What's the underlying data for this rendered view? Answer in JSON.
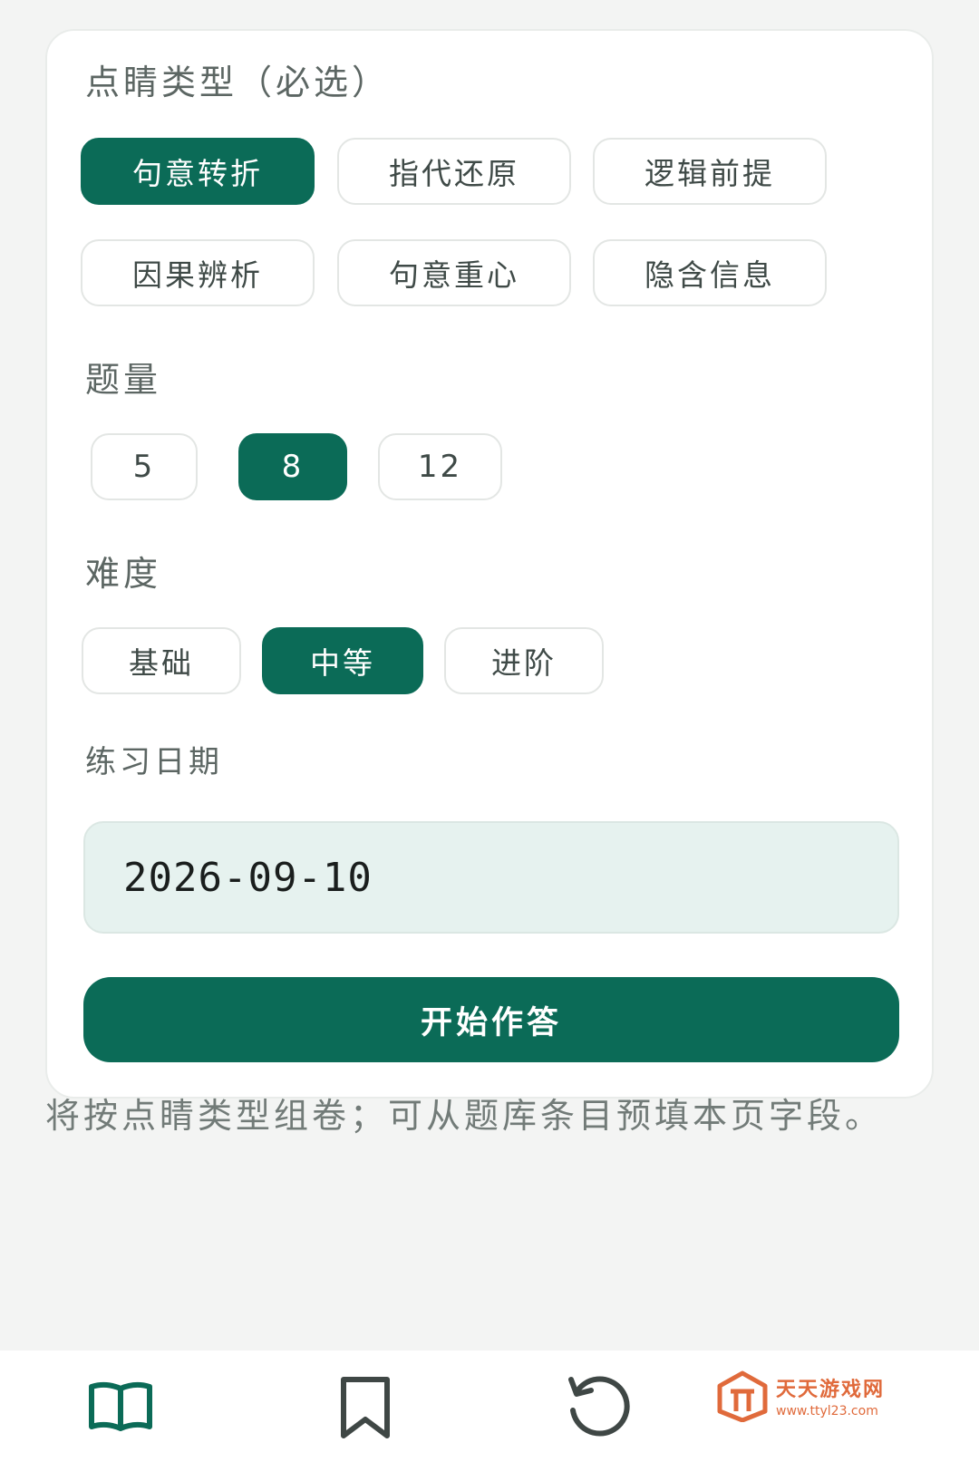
{
  "form": {
    "type_section": {
      "label": "点睛类型（必选）",
      "options": [
        {
          "label": "句意转折",
          "selected": true
        },
        {
          "label": "指代还原",
          "selected": false
        },
        {
          "label": "逻辑前提",
          "selected": false
        },
        {
          "label": "因果辨析",
          "selected": false
        },
        {
          "label": "句意重心",
          "selected": false
        },
        {
          "label": "隐含信息",
          "selected": false
        }
      ]
    },
    "count_section": {
      "label": "题量",
      "options": [
        {
          "label": "5",
          "selected": false
        },
        {
          "label": "8",
          "selected": true
        },
        {
          "label": "12",
          "selected": false
        }
      ]
    },
    "difficulty_section": {
      "label": "难度",
      "options": [
        {
          "label": "基础",
          "selected": false
        },
        {
          "label": "中等",
          "selected": true
        },
        {
          "label": "进阶",
          "selected": false
        }
      ]
    },
    "date_section": {
      "label": "练习日期",
      "value": "2026-09-10"
    },
    "start_button_label": "开始作答"
  },
  "hint": "将按点睛类型组卷；可从题库条目预填本页字段。",
  "colors": {
    "accent": "#0b6b57",
    "date_field_bg": "#e6f2ef",
    "page_bg": "#f3f4f3"
  },
  "bottom_nav": {
    "items": [
      {
        "icon": "book-open-icon",
        "active": true
      },
      {
        "icon": "bookmark-icon",
        "active": false
      },
      {
        "icon": "history-icon",
        "active": false
      }
    ]
  },
  "watermark": {
    "title": "天天游戏网",
    "url": "www.ttyl23.com"
  }
}
